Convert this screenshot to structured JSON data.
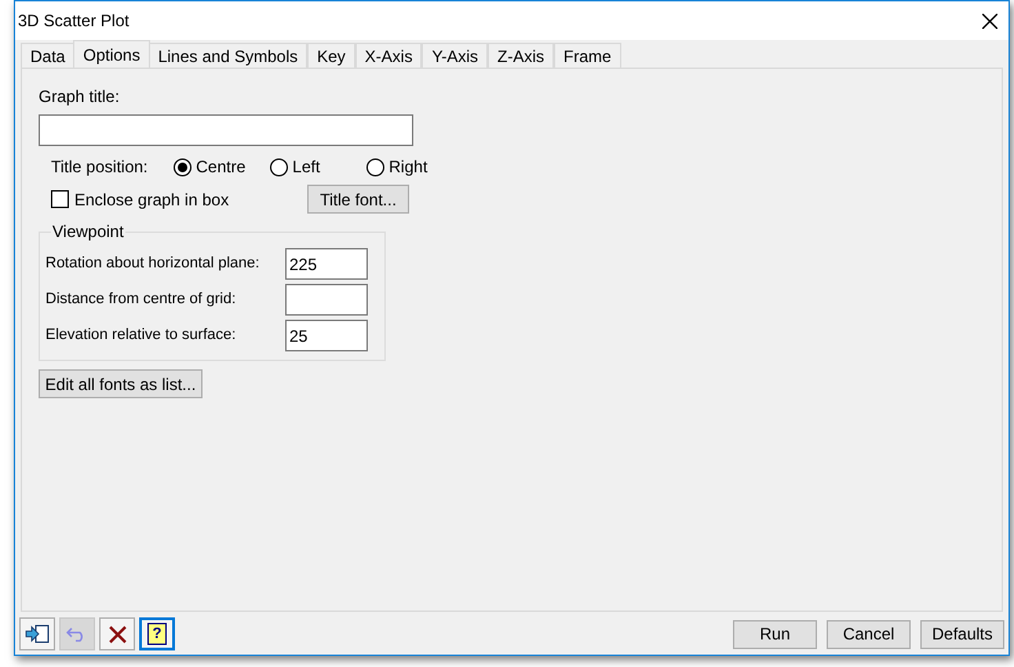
{
  "window": {
    "title": "3D Scatter Plot"
  },
  "tabs": [
    {
      "label": "Data",
      "selected": false
    },
    {
      "label": "Options",
      "selected": true
    },
    {
      "label": "Lines and Symbols",
      "selected": false
    },
    {
      "label": "Key",
      "selected": false
    },
    {
      "label": "X-Axis",
      "selected": false
    },
    {
      "label": "Y-Axis",
      "selected": false
    },
    {
      "label": "Z-Axis",
      "selected": false
    },
    {
      "label": "Frame",
      "selected": false
    }
  ],
  "graph_title": {
    "label": "Graph title:"
  },
  "title_position": {
    "label": "Title position:",
    "options": [
      {
        "label": "Centre",
        "selected": true
      },
      {
        "label": "Left",
        "selected": false
      },
      {
        "label": "Right",
        "selected": false
      }
    ]
  },
  "enclose_box": {
    "label": "Enclose graph in box",
    "checked": false
  },
  "title_font_button": "Title font...",
  "viewpoint": {
    "title": "Viewpoint",
    "fields": [
      {
        "label": "Rotation about horizontal plane:",
        "value": "225"
      },
      {
        "label": "Distance from centre of grid:"
      },
      {
        "label": "Elevation relative to surface:",
        "value": "25"
      }
    ]
  },
  "edit_fonts_button": "Edit all fonts as list...",
  "toolbar": [
    {
      "kind": "load",
      "disabled": false
    },
    {
      "kind": "undo",
      "disabled": true
    },
    {
      "kind": "clear",
      "disabled": false
    },
    {
      "kind": "help",
      "disabled": false,
      "label": "?"
    }
  ],
  "buttons": [
    "Run",
    "Cancel",
    "Defaults"
  ]
}
